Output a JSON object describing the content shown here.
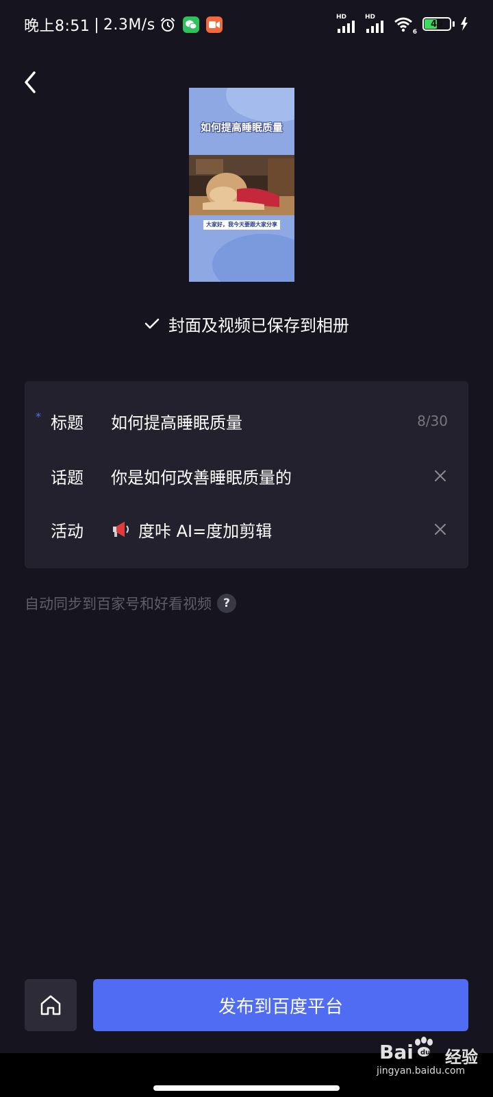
{
  "status_bar": {
    "time": "晚上8:51",
    "separator": "|",
    "speed": "2.3M/s",
    "signal_1_label": "HD",
    "signal_2_label": "HD",
    "wifi_label": "6",
    "battery_level": "49",
    "battery_fraction": 0.49,
    "icons": [
      "alarm-icon",
      "wechat-icon",
      "video-app-icon",
      "signal-icon",
      "wifi-icon",
      "battery-icon",
      "charging-icon"
    ]
  },
  "cover": {
    "title": "如何提高睡眠质量",
    "caption": "大家好，我今天要跟大家分享"
  },
  "saved_message": "封面及视频已保存到相册",
  "form": {
    "required_mark": "*",
    "title_label": "标题",
    "title_value": "如何提高睡眠质量",
    "title_count": "8/30",
    "topic_label": "话题",
    "topic_value": "你是如何改善睡眠质量的",
    "activity_label": "活动",
    "activity_value": "度咔 AI=度加剪辑"
  },
  "sync_text": "自动同步到百家号和好看视频",
  "help_label": "?",
  "publish_button": "发布到百度平台",
  "watermark": {
    "brand_left": "Bai",
    "brand_right": "经验",
    "url": "jingyan.baidu.com"
  },
  "colors": {
    "background": "#16151f",
    "card": "#22212d",
    "accent": "#4f6cf2",
    "muted_text": "#5e5d68"
  }
}
